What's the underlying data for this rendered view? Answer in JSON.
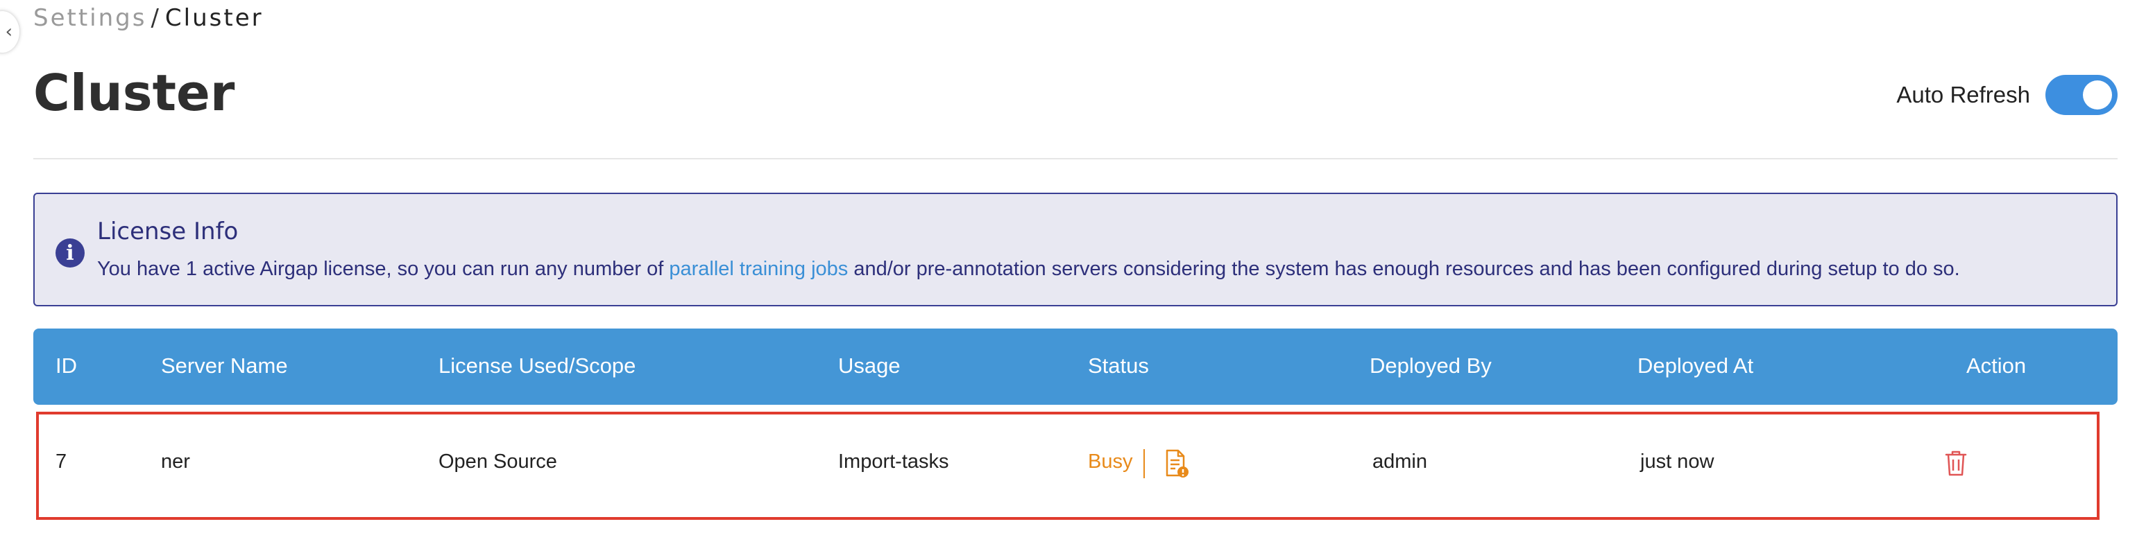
{
  "breadcrumb": {
    "parent": "Settings",
    "separator": "/",
    "current": "Cluster"
  },
  "page": {
    "title": "Cluster"
  },
  "auto_refresh": {
    "label": "Auto Refresh",
    "enabled": true
  },
  "license_info": {
    "title": "License Info",
    "text_before": "You have 1 active Airgap license, so you can run any number of ",
    "link_text": "parallel training jobs",
    "text_after": " and/or pre-annotation servers considering the system has enough resources and has been configured during setup to do so."
  },
  "table": {
    "headers": {
      "id": "ID",
      "server_name": "Server Name",
      "license": "License Used/Scope",
      "usage": "Usage",
      "status": "Status",
      "deployed_by": "Deployed By",
      "deployed_at": "Deployed At",
      "action": "Action"
    },
    "rows": [
      {
        "id": "7",
        "server_name": "ner",
        "license": "Open Source",
        "usage": "Import-tasks",
        "status": "Busy",
        "deployed_by": "admin",
        "deployed_at": "just now"
      }
    ]
  },
  "colors": {
    "accent": "#4496d6",
    "toggle": "#3d8fe0",
    "info_border": "#3a3f94",
    "info_bg": "#e8e8f2",
    "status_busy": "#e88a1a",
    "highlight_border": "#e03b2e",
    "delete": "#e05555"
  },
  "icons": {
    "sidebar_toggle": "chevron-left-icon",
    "info": "info-icon",
    "logs": "document-icon",
    "delete": "trash-icon"
  }
}
